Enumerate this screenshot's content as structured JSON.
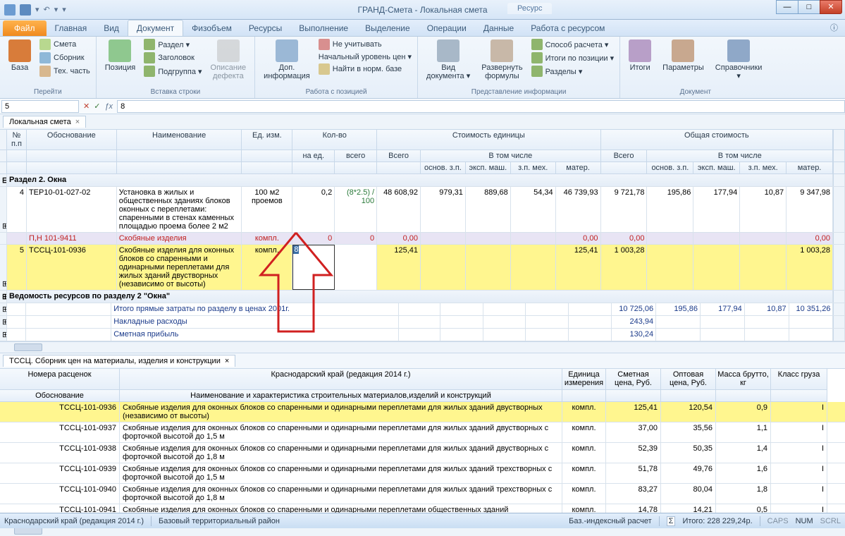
{
  "title": "ГРАНД-Смета - Локальная смета",
  "contextTab": "Ресурс",
  "menuTabs": {
    "file": "Файл",
    "items": [
      "Главная",
      "Вид",
      "Документ",
      "Физобъем",
      "Ресурсы",
      "Выполнение",
      "Выделение",
      "Операции",
      "Данные",
      "Работа с ресурсом"
    ],
    "active": 2
  },
  "ribbon": {
    "g1": {
      "label": "Перейти",
      "base": "База",
      "smeta": "Смета",
      "sbornik": "Сборник",
      "tech": "Тех. часть"
    },
    "g2": {
      "label": "Вставка строки",
      "pos": "Позиция",
      "razdel": "Раздел ▾",
      "zag": "Заголовок",
      "podgr": "Подгруппа ▾",
      "desc": "Описание\nдефекта"
    },
    "g3": {
      "label": "Работа с позицией",
      "dop": "Доп.\nинформация",
      "neuch": "Не учитывать",
      "nach": "Начальный уровень цен ▾",
      "norm": "Найти в норм. базе"
    },
    "g4": {
      "label": "Представление информации",
      "vid": "Вид\nдокумента ▾",
      "razv": "Развернуть\nформулы",
      "spos": "Способ расчета ▾",
      "itpos": "Итоги по позиции ▾",
      "razd": "Разделы ▾"
    },
    "g5": {
      "label": "Документ",
      "itogi": "Итоги",
      "param": "Параметры",
      "sprav": "Справочники\n▾"
    }
  },
  "fbar": {
    "name": "5",
    "formula": "8"
  },
  "docTab": "Локальная смета",
  "gridHead": {
    "num": "№\nп.п",
    "obo": "Обоснование",
    "naim": "Наименование",
    "ed": "Ед. изм.",
    "kol": "Кол-во",
    "kolu": "на ед.",
    "kolv": "всего",
    "stEd": "Стоимость единицы",
    "vsego": "Всего",
    "vtom": "В том числе",
    "osn": "основ. з.п.",
    "eksp": "эксп. маш.",
    "zpm": "з.п. мех.",
    "mat": "матер.",
    "obSt": "Общая стоимость"
  },
  "section": "Раздел 2. Окна",
  "rows": [
    {
      "num": "4",
      "obo": "ТЕР10-01-027-02",
      "naim": "Установка в жилых и общественных зданиях блоков оконных с переплетами: спаренными в стенах каменных площадью проема более 2 м2",
      "ed": "100 м2 проемов",
      "kolu": "0,2",
      "kolv": "(8*2.5) / 100",
      "vsego1": "48 608,92",
      "osn1": "979,31",
      "eksp1": "889,68",
      "zpm1": "54,34",
      "mat1": "46 739,93",
      "vsego2": "9 721,78",
      "osn2": "195,86",
      "eksp2": "177,94",
      "zpm2": "10,87",
      "mat2": "9 347,98"
    },
    {
      "violet": true,
      "red": true,
      "num": "",
      "obo": "П,Н            101-9411",
      "naim": "Скобяные изделия",
      "ed": "компл.",
      "kolu": "0",
      "kolv": "0",
      "vsego1": "0,00",
      "mat1": "0,00",
      "vsego2": "0,00",
      "mat2": "0,00"
    },
    {
      "yellow": true,
      "num": "5",
      "obo": "ТССЦ-101-0936",
      "naim": "Скобяные изделия для оконных блоков со спаренными и одинарными переплетами для жилых зданий двустворных (независимо от высоты)",
      "ed": "компл.",
      "kolu": "8",
      "editing": true,
      "vsego1": "125,41",
      "mat1": "125,41",
      "vsego2": "1 003,28",
      "mat2": "1 003,28"
    }
  ],
  "vedomost": "Ведомость ресурсов по разделу 2 \"Окна\"",
  "totals": [
    {
      "naim": "Итого прямые затраты по разделу в ценах 2001г.",
      "vsego2": "10 725,06",
      "osn2": "195,86",
      "eksp2": "177,94",
      "zpm2": "10,87",
      "mat2": "10 351,26"
    },
    {
      "naim": "Накладные расходы",
      "vsego2": "243,94"
    },
    {
      "naim": "Сметная прибыль",
      "vsego2": "130,24"
    }
  ],
  "bottom": {
    "tab": "ТССЦ. Сборник цен на материалы, изделия и конструкции",
    "region": "Краснодарский край (редакция 2014 г.)",
    "head": {
      "num": "Номера расценок",
      "obo": "Обоснование",
      "naimFull": "Наименование и характеристика строительных материалов,изделий и конструкций",
      "ed": "Единица измерения",
      "sm": "Сметная цена, Руб.",
      "opt": "Оптовая цена, Руб.",
      "mass": "Масса брутто, кг",
      "kl": "Класс груза"
    },
    "rows": [
      {
        "sel": true,
        "obo": "ТССЦ-101-0936",
        "naim": "Скобяные изделия для оконных блоков со спаренными и одинарными переплетами для жилых зданий двустворных (независимо от высоты)",
        "ed": "компл.",
        "sm": "125,41",
        "opt": "120,54",
        "mass": "0,9",
        "kl": "I"
      },
      {
        "obo": "ТССЦ-101-0937",
        "naim": "Скобяные изделия для оконных блоков со спаренными и одинарными переплетами для жилых зданий двустворных с форточкой высотой до 1,5 м",
        "ed": "компл.",
        "sm": "37,00",
        "opt": "35,56",
        "mass": "1,1",
        "kl": "I"
      },
      {
        "obo": "ТССЦ-101-0938",
        "naim": "Скобяные изделия для оконных блоков со спаренными и одинарными переплетами для жилых зданий двустворных с форточкой высотой до 1,8 м",
        "ed": "компл.",
        "sm": "52,39",
        "opt": "50,35",
        "mass": "1,4",
        "kl": "I"
      },
      {
        "obo": "ТССЦ-101-0939",
        "naim": "Скобяные изделия для оконных блоков со спаренными и одинарными переплетами для жилых зданий трехстворных с форточкой высотой до 1,5 м",
        "ed": "компл.",
        "sm": "51,78",
        "opt": "49,76",
        "mass": "1,6",
        "kl": "I"
      },
      {
        "obo": "ТССЦ-101-0940",
        "naim": "Скобяные изделия для оконных блоков со спаренными и одинарными переплетами для жилых зданий трехстворных с форточкой высотой до 1,8 м",
        "ed": "компл.",
        "sm": "83,27",
        "opt": "80,04",
        "mass": "1,8",
        "kl": "I"
      },
      {
        "obo": "ТССЦ-101-0941",
        "naim": "Скобяные изделия для оконных блоков со спаренными и одинарными переплетами общественных зданий одностворных высотой",
        "ed": "компл.",
        "sm": "14,78",
        "opt": "14,21",
        "mass": "0,5",
        "kl": "I"
      }
    ]
  },
  "status": {
    "region": "Краснодарский край (редакция 2014 г.)",
    "base": "Базовый территориальный район",
    "calc": "Баз.-индексный расчет",
    "itogo": "Итого: 228 229,24р.",
    "caps": "CAPS",
    "num": "NUM",
    "scrl": "SCRL"
  }
}
